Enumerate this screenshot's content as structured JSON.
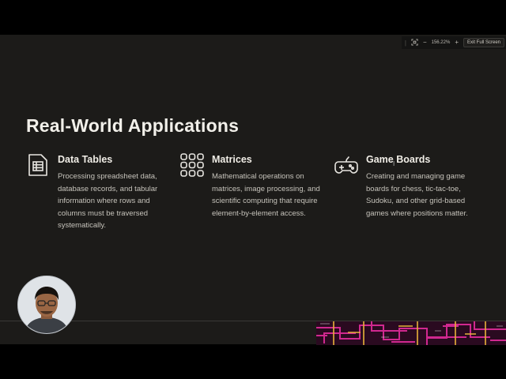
{
  "toolbar": {
    "separator": "|",
    "zoom_level": "156.22%",
    "zoom_out_symbol": "−",
    "zoom_in_symbol": "+",
    "exit_label": "Exit Full Screen"
  },
  "slide": {
    "title": "Real-World Applications",
    "cards": [
      {
        "icon": "table-icon",
        "title": "Data Tables",
        "body": "Processing spreadsheet data, database records, and tabular information where rows and columns must be traversed systematically."
      },
      {
        "icon": "grid-dots-icon",
        "title": "Matrices",
        "body": "Mathematical operations on matrices, image processing, and scientific computing that require element-by-element access."
      },
      {
        "icon": "gamepad-icon",
        "title": "Game Boards",
        "body": "Creating and managing game boards for chess, tic-tac-toe, Sudoku, and other grid-based games where positions matter."
      }
    ]
  },
  "colors": {
    "slide_bg": "#1c1b19",
    "title": "#f2f0ea",
    "body_text": "#c6c3bb",
    "strip_magenta": "#d0288f",
    "strip_amber": "#e8b23a"
  }
}
